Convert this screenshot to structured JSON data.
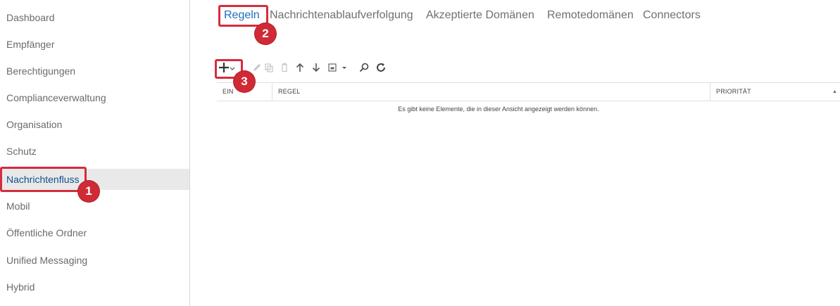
{
  "sidebar": {
    "items": [
      {
        "label": "Dashboard"
      },
      {
        "label": "Empfänger"
      },
      {
        "label": "Berechtigungen"
      },
      {
        "label": "Complianceverwaltung"
      },
      {
        "label": "Organisation"
      },
      {
        "label": "Schutz"
      },
      {
        "label": "Nachrichtenfluss",
        "active": true
      },
      {
        "label": "Mobil"
      },
      {
        "label": "Öffentliche Ordner"
      },
      {
        "label": "Unified Messaging"
      },
      {
        "label": "Hybrid"
      }
    ]
  },
  "tabs": [
    {
      "label": "Regeln",
      "active": true
    },
    {
      "label": "Nachrichtenablaufverfolgung"
    },
    {
      "label": "Akzeptierte Domänen"
    },
    {
      "label": "Remotedomänen"
    },
    {
      "label": "Connectors"
    }
  ],
  "toolbar": {
    "icons": [
      "add-icon",
      "edit-icon",
      "copy-icon",
      "delete-icon",
      "move-up-icon",
      "move-down-icon",
      "export-icon",
      "search-icon",
      "refresh-icon"
    ]
  },
  "table": {
    "columns": [
      {
        "label": "EIN"
      },
      {
        "label": "REGEL"
      },
      {
        "label": "PRIORITÄT"
      }
    ],
    "sort_indicator": "▲",
    "empty_message": "Es gibt keine Elemente, die in dieser Ansicht angezeigt werden können."
  },
  "annotations": {
    "callouts": [
      "1",
      "2",
      "3"
    ],
    "color": "#d42d3c"
  }
}
